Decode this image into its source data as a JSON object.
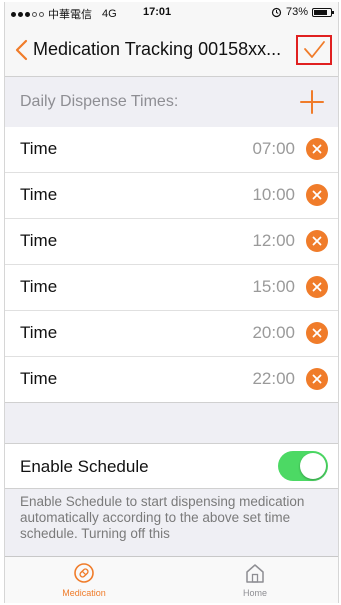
{
  "status_bar": {
    "carrier": "中華電信",
    "network": "4G",
    "time": "17:01",
    "battery_text": "73%",
    "battery_level": 0.73
  },
  "nav": {
    "title": "Medication Tracking 00158xx...",
    "accent_color": "#f07c2a",
    "highlight_color": "#e02020"
  },
  "dispense": {
    "header": "Daily Dispense Times:",
    "rows": [
      {
        "label": "Time",
        "value": "07:00"
      },
      {
        "label": "Time",
        "value": "10:00"
      },
      {
        "label": "Time",
        "value": "12:00"
      },
      {
        "label": "Time",
        "value": "15:00"
      },
      {
        "label": "Time",
        "value": "20:00"
      },
      {
        "label": "Time",
        "value": "22:00"
      }
    ]
  },
  "schedule": {
    "label": "Enable Schedule",
    "enabled": true,
    "toggle_color": "#4cd964",
    "description": "Enable Schedule to start dispensing medication automatically according to the above set time schedule. Turning off this"
  },
  "tabbar": {
    "tabs": [
      {
        "label": "Medication",
        "icon": "pill-icon",
        "active": true
      },
      {
        "label": "Home",
        "icon": "home-icon",
        "active": false
      }
    ]
  }
}
